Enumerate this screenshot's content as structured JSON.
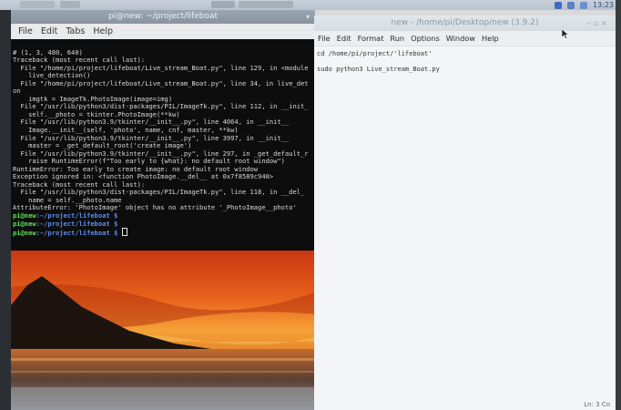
{
  "taskbar": {
    "clock": "13:23",
    "tray_icons": [
      "bluetooth-icon",
      "wifi-icon",
      "volume-icon"
    ]
  },
  "terminal": {
    "title": "pi@new: ~/project/lifeboat",
    "menu": [
      "File",
      "Edit",
      "Tabs",
      "Help"
    ],
    "lines": [
      {
        "t": "# (1, 3, 480, 640)"
      },
      {
        "t": "Traceback (most recent call last):"
      },
      {
        "t": "  File \"/home/pi/project/lifeboat/Live_stream_Boat.py\", line 129, in <module"
      },
      {
        "t": "    live_detection()"
      },
      {
        "t": "  File \"/home/pi/project/lifeboat/Live_stream_Boat.py\", line 34, in live_det"
      },
      {
        "t": "on"
      },
      {
        "t": "    imgtk = ImageTk.PhotoImage(image=img)"
      },
      {
        "t": "  File \"/usr/lib/python3/dist-packages/PIL/ImageTk.py\", line 112, in __init_"
      },
      {
        "t": "    self.__photo = tkinter.PhotoImage(**kw)"
      },
      {
        "t": "  File \"/usr/lib/python3.9/tkinter/__init__.py\", line 4064, in __init__"
      },
      {
        "t": "    Image.__init__(self, 'photo', name, cnf, master, **kw)"
      },
      {
        "t": "  File \"/usr/lib/python3.9/tkinter/__init__.py\", line 3997, in __init__"
      },
      {
        "t": "    master = _get_default_root('create image')"
      },
      {
        "t": "  File \"/usr/lib/python3.9/tkinter/__init__.py\", line 297, in _get_default_r"
      },
      {
        "t": "    raise RuntimeError(f\"Too early to {what}: no default root window\")"
      },
      {
        "t": "RuntimeError: Too early to create image: no default root window"
      },
      {
        "t": "Exception ignored in: <function PhotoImage.__del__ at 0x7f8589c940>"
      },
      {
        "t": "Traceback (most recent call last):"
      },
      {
        "t": "  File \"/usr/lib/python3/dist-packages/PIL/ImageTk.py\", line 118, in __del_"
      },
      {
        "t": "    name = self.__photo.name"
      },
      {
        "t": "AttributeError: 'PhotoImage' object has no attribute '_PhotoImage__photo'"
      }
    ],
    "prompts": [
      {
        "user": "pi@new",
        "path": ":~/project/lifeboat $",
        "cmd": ""
      },
      {
        "user": "pi@new",
        "path": ":~/project/lifeboat $",
        "cmd": ""
      },
      {
        "user": "pi@new",
        "path": ":~/project/lifeboat $",
        "cmd": ""
      }
    ]
  },
  "editor": {
    "title": "new - /home/pi/Desktop/new (3.9.2)",
    "menu": [
      "File",
      "Edit",
      "Format",
      "Run",
      "Options",
      "Window",
      "Help"
    ],
    "lines": [
      "cd /home/pi/project/'lifeboat'",
      "",
      "sudo python3 Live_stream_Boat.py"
    ],
    "status": "Ln: 3  Co"
  }
}
